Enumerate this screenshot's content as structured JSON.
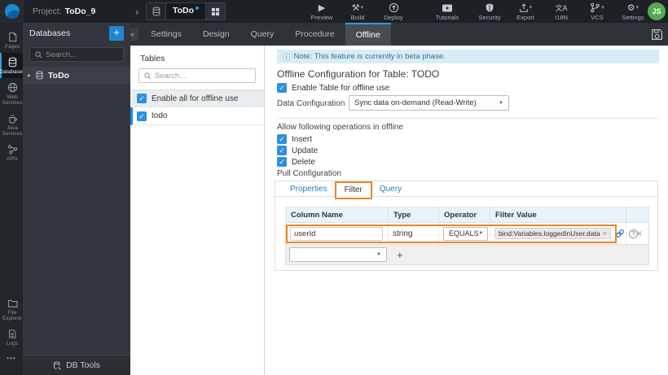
{
  "colors": {
    "accent_blue": "#2e9fd8",
    "checkbox_blue": "#2d8fe2",
    "annotation_orange": "#ee8326",
    "avatar_green": "#55a954",
    "note_bg": "#d9ecf6"
  },
  "icons": {
    "info": "ⓘ",
    "chevron_right": "›",
    "caret_right": "▸",
    "dropdown": "▾",
    "select_arrow": "▼",
    "close": "×",
    "plus": "+",
    "more": "•••",
    "check": "✓",
    "collapse": "«",
    "help": "?",
    "play": "▶",
    "build": "⚒",
    "gear": "⚙",
    "i18n": "文A"
  },
  "topbar": {
    "project_label": "Project:",
    "project_name": "ToDo_9",
    "artifact": {
      "name": "ToDo"
    },
    "actions": [
      {
        "label": "Preview"
      },
      {
        "label": "Build"
      },
      {
        "label": "Deploy"
      },
      {
        "label": "Tutorials"
      }
    ],
    "right_actions": [
      {
        "label": "Security"
      },
      {
        "label": "Export"
      },
      {
        "label": "I18N"
      },
      {
        "label": "VCS"
      },
      {
        "label": "Settings"
      }
    ],
    "avatar": "JS"
  },
  "sidebar": {
    "items": [
      {
        "label": "Pages"
      },
      {
        "label": "Databases"
      },
      {
        "label": "Web Services"
      },
      {
        "label": "Java Services"
      },
      {
        "label": "APIs"
      }
    ],
    "bottom_items": [
      {
        "label": "File Explorer"
      },
      {
        "label": "Logs"
      }
    ]
  },
  "db_panel": {
    "title": "Databases",
    "search_placeholder": "Search...",
    "items": [
      {
        "name": "ToDo"
      }
    ],
    "footer": "DB Tools"
  },
  "tables_panel": {
    "title": "Tables",
    "search_placeholder": "Search...",
    "enable_all_label": "Enable all for offline use",
    "tables": [
      {
        "name": "todo"
      }
    ]
  },
  "tabbar": {
    "tabs": [
      {
        "label": "Settings"
      },
      {
        "label": "Design"
      },
      {
        "label": "Query"
      },
      {
        "label": "Procedure"
      },
      {
        "label": "Offline"
      }
    ]
  },
  "main": {
    "note": "Note: This feature is currently in beta phase.",
    "heading": "Offline Configuration for Table: TODO",
    "enable_table_label": "Enable Table for offline use",
    "data_configuration": {
      "label": "Data Configuration",
      "value": "Sync data on-demand (Read-Write)"
    },
    "operations": {
      "label": "Allow following operations in offline",
      "items": [
        {
          "label": "Insert"
        },
        {
          "label": "Update"
        },
        {
          "label": "Delete"
        }
      ]
    },
    "pull_configuration": {
      "label": "Pull Configuration",
      "tabs": [
        {
          "label": "Properties"
        },
        {
          "label": "Filter"
        },
        {
          "label": "Query"
        }
      ],
      "filter_table": {
        "headers": [
          "Column Name",
          "Type",
          "Operator",
          "Filter Value",
          ""
        ],
        "rows": [
          {
            "column_name": "userId",
            "type": "string",
            "operator": "EQUALS",
            "filter_value": "bind:Variables.loggedInUser.data"
          }
        ]
      }
    }
  }
}
